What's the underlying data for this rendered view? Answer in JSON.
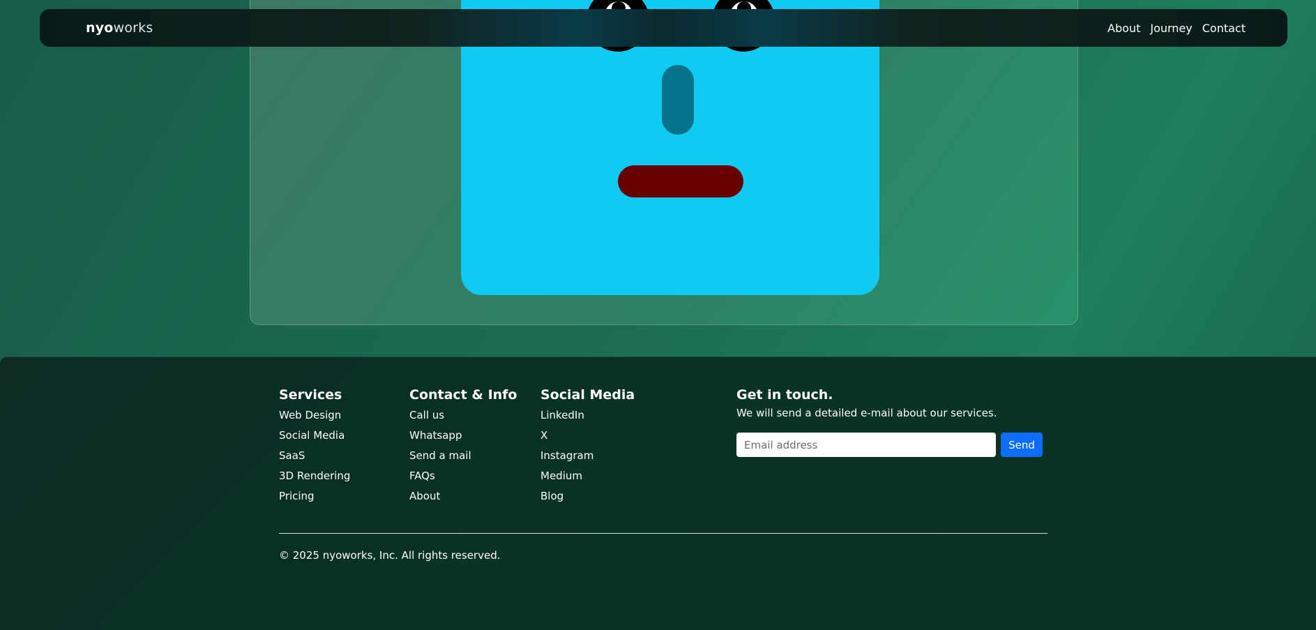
{
  "nav": {
    "brand_bold": "nyo",
    "brand_light": "works",
    "links": [
      "About",
      "Journey",
      "Contact"
    ]
  },
  "footer": {
    "services": {
      "title": "Services",
      "items": [
        "Web Design",
        "Social Media",
        "SaaS",
        "3D Rendering",
        "Pricing"
      ]
    },
    "contact": {
      "title": "Contact & Info",
      "items": [
        "Call us",
        "Whatsapp",
        "Send a mail",
        "FAQs",
        "About"
      ]
    },
    "social": {
      "title": "Social Media",
      "items": [
        "LinkedIn",
        "X",
        "Instagram",
        "Medium",
        "Blog"
      ]
    },
    "touch": {
      "title": "Get in touch.",
      "subtitle": "We will send a detailed e-mail about our services.",
      "email_placeholder": "Email address",
      "send_label": "Send"
    },
    "copyright": "© 2025 nyoworks, Inc. All rights reserved."
  },
  "colors": {
    "face": "#10cbf1",
    "mouth": "#690000",
    "nose": "#07738b",
    "send_button": "#0d6efd"
  }
}
